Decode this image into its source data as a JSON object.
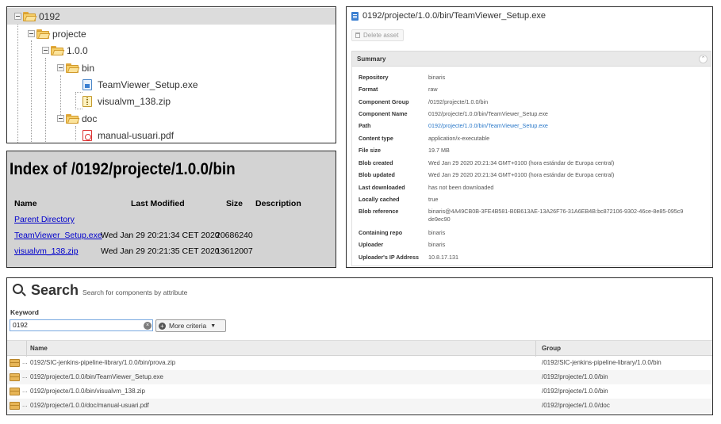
{
  "tree": {
    "nodes": [
      {
        "label": "0192",
        "type": "folder",
        "selected": true
      },
      {
        "label": "projecte",
        "type": "folder"
      },
      {
        "label": "1.0.0",
        "type": "folder"
      },
      {
        "label": "bin",
        "type": "folder"
      },
      {
        "label": "TeamViewer_Setup.exe",
        "type": "exe-file"
      },
      {
        "label": "visualvm_138.zip",
        "type": "zip-file"
      },
      {
        "label": "doc",
        "type": "folder"
      },
      {
        "label": "manual-usuari.pdf",
        "type": "pdf-file"
      }
    ]
  },
  "asset": {
    "title": "0192/projecte/1.0.0/bin/TeamViewer_Setup.exe",
    "delete_label": "Delete asset",
    "summary_title": "Summary",
    "collapse_glyph": "⌃",
    "fields": [
      {
        "key": "Repository",
        "value": "binaris"
      },
      {
        "key": "Format",
        "value": "raw"
      },
      {
        "key": "Component Group",
        "value": "/0192/projecte/1.0.0/bin"
      },
      {
        "key": "Component Name",
        "value": "0192/projecte/1.0.0/bin/TeamViewer_Setup.exe"
      },
      {
        "key": "Path",
        "value": "0192/projecte/1.0.0/bin/TeamViewer_Setup.exe",
        "link": true
      },
      {
        "key": "Content type",
        "value": "application/x-executable"
      },
      {
        "key": "File size",
        "value": "19.7 MB"
      },
      {
        "key": "Blob created",
        "value": "Wed Jan 29 2020 20:21:34 GMT+0100 (hora estándar de Europa central)"
      },
      {
        "key": "Blob updated",
        "value": "Wed Jan 29 2020 20:21:34 GMT+0100 (hora estándar de Europa central)"
      },
      {
        "key": "Last downloaded",
        "value": "has not been downloaded"
      },
      {
        "key": "Locally cached",
        "value": "true"
      },
      {
        "key": "Blob reference",
        "value": "binaris@4A49CB0B-3FE4B581-B0B613AE-13A26F76-31A6EB4B:bc872106-9302-46ce-8e85-095c9",
        "value2": "de9ec90"
      },
      {
        "key": "Containing repo",
        "value": "binaris"
      },
      {
        "key": "Uploader",
        "value": "binaris"
      },
      {
        "key": "Uploader's IP Address",
        "value": "10.8.17.131"
      }
    ]
  },
  "index": {
    "title": "Index of /0192/projecte/1.0.0/bin",
    "headers": {
      "name": "Name",
      "modified": "Last Modified",
      "size": "Size",
      "description": "Description"
    },
    "parent_label": "Parent Directory",
    "rows": [
      {
        "name": "TeamViewer_Setup.exe",
        "modified": "Wed Jan 29 20:21:34 CET 2020",
        "size": "20686240"
      },
      {
        "name": "visualvm_138.zip",
        "modified": "Wed Jan 29 20:21:35 CET 2020",
        "size": "13612007"
      }
    ]
  },
  "search": {
    "title": "Search",
    "subtitle": "Search for components by attribute",
    "keyword_label": "Keyword",
    "keyword_value": "0192",
    "clear_glyph": "×",
    "more_label": "More criteria",
    "plus_glyph": "+",
    "caret_glyph": "▼",
    "columns": {
      "name": "Name",
      "group": "Group"
    },
    "ellipsis": "...",
    "results": [
      {
        "name": "0192/SIC-jenkins-pipeline-library/1.0.0/bin/prova.zip",
        "group": "/0192/SIC-jenkins-pipeline-library/1.0.0/bin"
      },
      {
        "name": "0192/projecte/1.0.0/bin/TeamViewer_Setup.exe",
        "group": "/0192/projecte/1.0.0/bin"
      },
      {
        "name": "0192/projecte/1.0.0/bin/visualvm_138.zip",
        "group": "/0192/projecte/1.0.0/bin"
      },
      {
        "name": "0192/projecte/1.0.0/doc/manual-usuari.pdf",
        "group": "/0192/projecte/1.0.0/doc"
      }
    ]
  }
}
